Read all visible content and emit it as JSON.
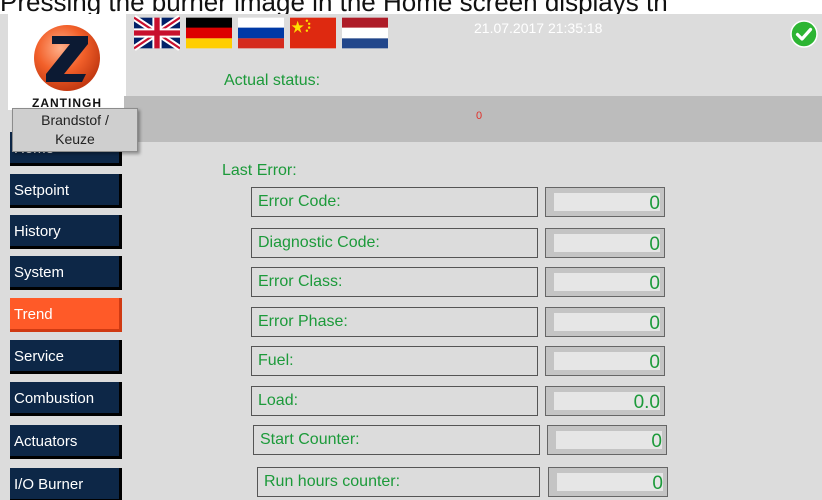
{
  "caption": "Pressing the burner image in the Home screen displays th",
  "header": {
    "datetime": "21.07.2017  21:35:18",
    "flags": [
      "uk-flag-icon",
      "germany-flag-icon",
      "russia-flag-icon",
      "china-flag-icon",
      "netherlands-flag-icon"
    ],
    "status_icon": "check-circle-icon"
  },
  "logo": {
    "word": "ZANTINGH"
  },
  "tooltip": {
    "line1": "Brandstof /",
    "line2": "Keuze"
  },
  "main": {
    "actual_status_label": "Actual status:",
    "actual_status_value": "0",
    "last_error_label": "Last Error:"
  },
  "nav": {
    "home": "Home",
    "setpoint": "Setpoint",
    "history": "History",
    "system": "System",
    "trend": "Trend",
    "service": "Service",
    "combustion": "Combustion",
    "actuators": "Actuators",
    "io_burner": "I/O Burner"
  },
  "errors": [
    {
      "label": "Error Code:",
      "value": "0"
    },
    {
      "label": "Diagnostic Code:",
      "value": "0"
    },
    {
      "label": "Error Class:",
      "value": "0"
    },
    {
      "label": "Error Phase:",
      "value": "0"
    },
    {
      "label": "Fuel:",
      "value": "0"
    },
    {
      "label": "Load:",
      "value": "0.0"
    },
    {
      "label": "Start Counter:",
      "value": "0"
    },
    {
      "label": "Run hours counter:",
      "value": "0"
    }
  ],
  "colors": {
    "nav": "#0d2747",
    "nav_active": "#ff5a28",
    "label_green": "#1c9a3a",
    "status_ok": "#2db533"
  }
}
